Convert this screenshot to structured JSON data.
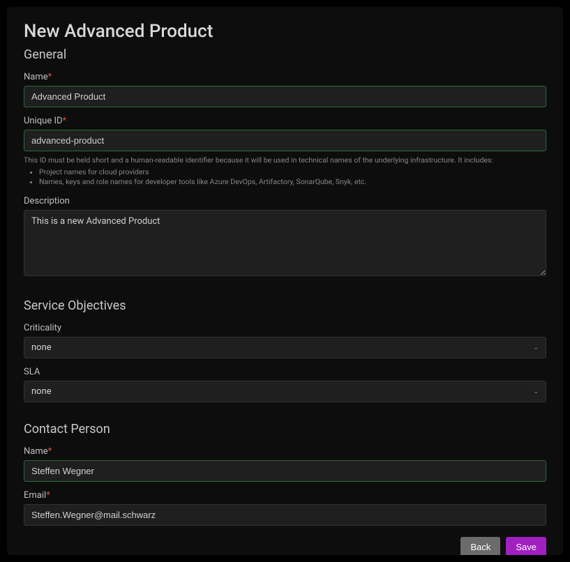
{
  "page": {
    "title": "New Advanced Product"
  },
  "sections": {
    "general": {
      "heading": "General",
      "name": {
        "label": "Name",
        "value": "Advanced Product"
      },
      "uniqueId": {
        "label": "Unique ID",
        "value": "advanced-product",
        "helpIntro": "This ID must be held short and a human-readable identifier because it will be used in technical names of the underlying infrastructure. It includes:",
        "helpItem1": "Project names for cloud providers",
        "helpItem2": "Names, keys and role names for developer tools like Azure DevOps, Artifactory, SonarQube, Snyk, etc."
      },
      "description": {
        "label": "Description",
        "value": "This is a new Advanced Product"
      }
    },
    "serviceObjectives": {
      "heading": "Service Objectives",
      "criticality": {
        "label": "Criticality",
        "value": "none"
      },
      "sla": {
        "label": "SLA",
        "value": "none"
      }
    },
    "contactPerson": {
      "heading": "Contact Person",
      "name": {
        "label": "Name",
        "value": "Steffen Wegner"
      },
      "email": {
        "label": "Email",
        "value": "Steffen.Wegner@mail.schwarz"
      }
    }
  },
  "buttons": {
    "back": "Back",
    "save": "Save"
  }
}
